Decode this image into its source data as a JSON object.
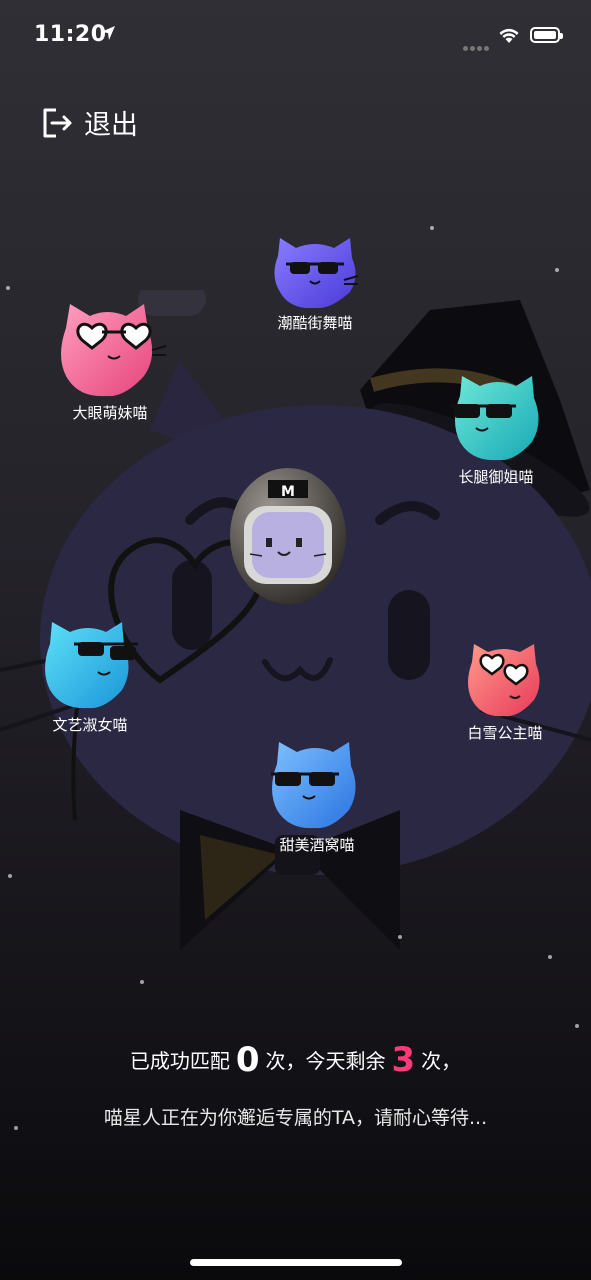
{
  "status_bar": {
    "time": "11:20"
  },
  "header": {
    "exit_label": "退出"
  },
  "cats": [
    {
      "name": "潮酷街舞喵",
      "color": "#5b4ae8",
      "color2": "#8a7cff",
      "glasses": "black"
    },
    {
      "name": "大眼萌妹喵",
      "color": "#f2608e",
      "color2": "#ff9ec0",
      "glasses": "heart"
    },
    {
      "name": "长腿御姐喵",
      "color": "#1ec8b0",
      "color2": "#5ee8d4",
      "glasses": "black"
    },
    {
      "name": "文艺淑女喵",
      "color": "#18b8e0",
      "color2": "#64dcf6",
      "glasses": "black"
    },
    {
      "name": "白雪公主喵",
      "color": "#f25b6a",
      "color2": "#ff9a9a",
      "glasses": "heart"
    },
    {
      "name": "甜美酒窝喵",
      "color": "#3a8cf0",
      "color2": "#7cc0ff",
      "glasses": "black"
    }
  ],
  "stats": {
    "prefix": "已成功匹配",
    "matched": "0",
    "mid": "次，今天剩余",
    "remaining": "3",
    "suffix": "次，"
  },
  "wait_text": "喵星人正在为你邂逅专属的TA，请耐心等待..."
}
